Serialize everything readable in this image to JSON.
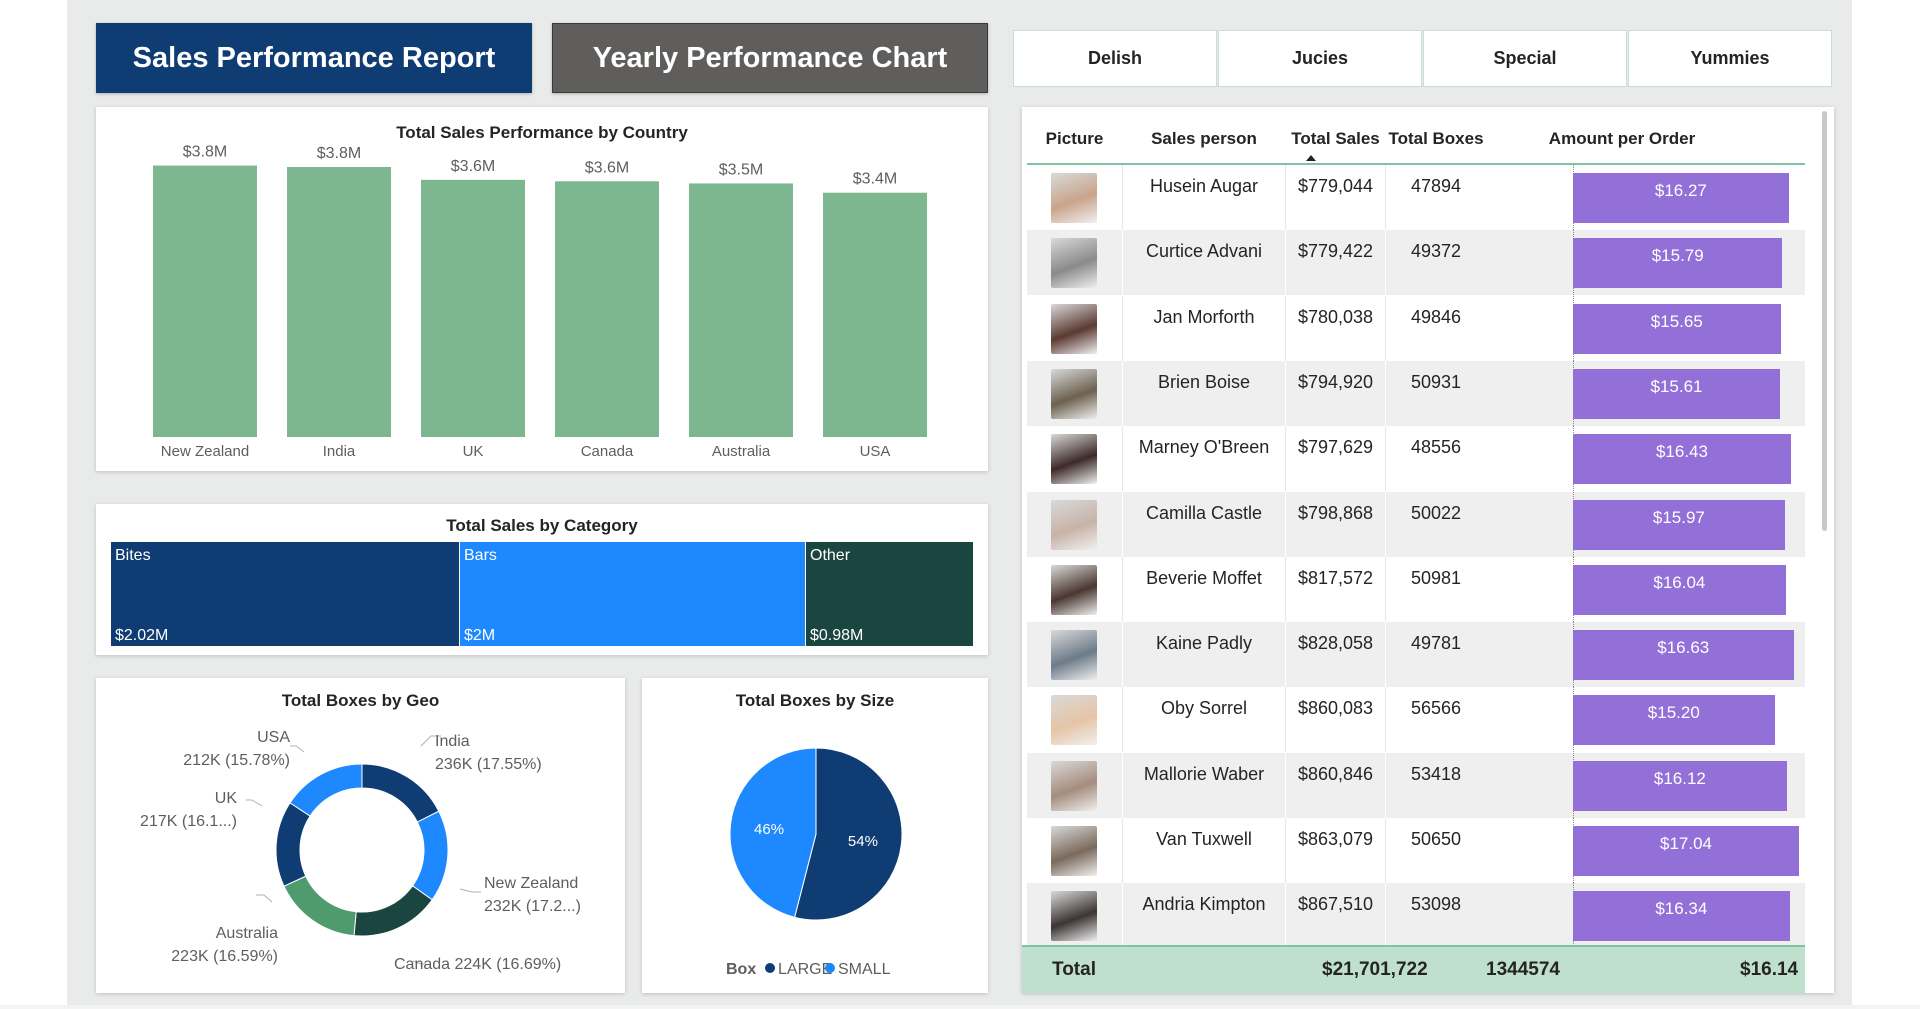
{
  "header": {
    "report_button": "Sales Performance Report",
    "yearly_button": "Yearly Performance Chart"
  },
  "product_tabs": [
    "Delish",
    "Jucies",
    "Special",
    "Yummies"
  ],
  "colors": {
    "bar_green": "#7cb78f",
    "purple_bar": "#9370d8",
    "navy": "#0f3d73",
    "blue": "#1e88ff",
    "dark_teal": "#1a4541",
    "total_row": "#bfe0cd"
  },
  "chart_data": [
    {
      "type": "bar",
      "title": "Total Sales Performance by Country",
      "categories": [
        "New Zealand",
        "India",
        "UK",
        "Canada",
        "Australia",
        "USA"
      ],
      "values": [
        3.8,
        3.78,
        3.6,
        3.58,
        3.55,
        3.42
      ],
      "data_labels": [
        "$3.8M",
        "$3.8M",
        "$3.6M",
        "$3.6M",
        "$3.5M",
        "$3.4M"
      ],
      "ylim": [
        0,
        4.2
      ],
      "grid": false
    },
    {
      "type": "treemap",
      "title": "Total Sales by Category",
      "categories": [
        "Bites",
        "Bars",
        "Other"
      ],
      "values": [
        2.02,
        2.0,
        0.98
      ],
      "data_labels": [
        "$2.02M",
        "$2M",
        "$0.98M"
      ],
      "colors": [
        "#0f3d73",
        "#1e88ff",
        "#1a4541"
      ]
    },
    {
      "type": "pie",
      "subtype": "donut",
      "title": "Total Boxes by Geo",
      "categories": [
        "India",
        "New Zealand",
        "Canada",
        "Australia",
        "UK",
        "USA"
      ],
      "values": [
        236,
        232,
        224,
        223,
        217,
        212
      ],
      "label_lines": [
        [
          "India",
          "236K (17.55%)"
        ],
        [
          "New Zealand",
          "232K (17.2...)"
        ],
        [
          "Canada 224K (16.69%)"
        ],
        [
          "Australia",
          "223K (16.59%)"
        ],
        [
          "UK",
          "217K (16.1...)"
        ],
        [
          "USA",
          "212K (15.78%)"
        ]
      ],
      "colors": [
        "#0f3d73",
        "#1e88ff",
        "#1a4541",
        "#4f9b6e",
        "#0f3d73",
        "#1e88ff"
      ]
    },
    {
      "type": "pie",
      "title": "Total Boxes by Size",
      "legend_title": "Box",
      "categories": [
        "LARGE",
        "SMALL"
      ],
      "values": [
        54,
        46
      ],
      "data_labels": [
        "54%",
        "46%"
      ],
      "colors": [
        "#0f3d73",
        "#1e88ff"
      ],
      "legend": "bottom"
    }
  ],
  "table": {
    "columns": [
      "Picture",
      "Sales person",
      "Total Sales",
      "Total Boxes",
      "Amount per Order"
    ],
    "rows": [
      {
        "name": "Husein Augar",
        "sales": "$779,044",
        "boxes": "47894",
        "amount": "$16.27",
        "amount_value": 16.27
      },
      {
        "name": "Curtice Advani",
        "sales": "$779,422",
        "boxes": "49372",
        "amount": "$15.79",
        "amount_value": 15.79
      },
      {
        "name": "Jan Morforth",
        "sales": "$780,038",
        "boxes": "49846",
        "amount": "$15.65",
        "amount_value": 15.65
      },
      {
        "name": "Brien Boise",
        "sales": "$794,920",
        "boxes": "50931",
        "amount": "$15.61",
        "amount_value": 15.61
      },
      {
        "name": "Marney O'Breen",
        "sales": "$797,629",
        "boxes": "48556",
        "amount": "$16.43",
        "amount_value": 16.43
      },
      {
        "name": "Camilla Castle",
        "sales": "$798,868",
        "boxes": "50022",
        "amount": "$15.97",
        "amount_value": 15.97
      },
      {
        "name": "Beverie Moffet",
        "sales": "$817,572",
        "boxes": "50981",
        "amount": "$16.04",
        "amount_value": 16.04
      },
      {
        "name": "Kaine Padly",
        "sales": "$828,058",
        "boxes": "49781",
        "amount": "$16.63",
        "amount_value": 16.63
      },
      {
        "name": "Oby Sorrel",
        "sales": "$860,083",
        "boxes": "56566",
        "amount": "$15.20",
        "amount_value": 15.2
      },
      {
        "name": "Mallorie Waber",
        "sales": "$860,846",
        "boxes": "53418",
        "amount": "$16.12",
        "amount_value": 16.12
      },
      {
        "name": "Van Tuxwell",
        "sales": "$863,079",
        "boxes": "50650",
        "amount": "$17.04",
        "amount_value": 17.04
      },
      {
        "name": "Andria Kimpton",
        "sales": "$867,510",
        "boxes": "53098",
        "amount": "$16.34",
        "amount_value": 16.34
      }
    ],
    "total": {
      "label": "Total",
      "sales": "$21,701,722",
      "boxes": "1344574",
      "amount": "$16.14"
    }
  }
}
